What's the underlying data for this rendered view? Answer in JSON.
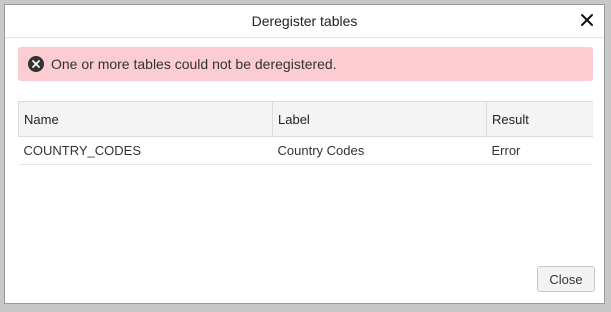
{
  "dialog": {
    "title": "Deregister tables",
    "close_icon": "close-icon"
  },
  "alert": {
    "icon": "error-circle-icon",
    "message": "One or more tables could not be deregistered.",
    "background_color": "#fbcdd2"
  },
  "table": {
    "columns": [
      "Name",
      "Label",
      "Result"
    ],
    "rows": [
      {
        "name": "COUNTRY_CODES",
        "label": "Country Codes",
        "result": "Error"
      }
    ],
    "error_color": "#e0443a"
  },
  "footer": {
    "close_label": "Close"
  }
}
